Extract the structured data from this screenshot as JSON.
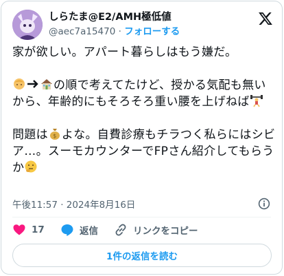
{
  "author": {
    "display_name": "しらたま@E2/AMH極低値",
    "handle": "@aec7a15470",
    "separator": "·",
    "follow_label": "フォローする"
  },
  "tweet": {
    "line1": "家が欲しい。アパート暮らしはもう嫌だ。",
    "para2_after_arrows": "の順で考えてたけど、授かる気配も無いから、年齢的にもそろそろ重い腰を上げねば",
    "para3_start": "問題は",
    "para3_after_bag": "よな。自費診療もチラつく私らにはシビア…。スーモカウンターでFPさん紹介してもらうか",
    "emoji_names": [
      "baby-icon",
      "arrow-right-icon",
      "house-icon",
      "weightlifter-icon",
      "money-bag-icon",
      "thinking-face-icon"
    ]
  },
  "timestamp": "午後11:57 · 2024年8月16日",
  "actions": {
    "like_count": "17",
    "reply_label": "返信",
    "copy_link_label": "リンクをコピー",
    "like_color": "#f91880"
  },
  "read_replies_label": "1件の返信を読む",
  "colors": {
    "accent": "#1d9bf0",
    "muted": "#536471"
  }
}
